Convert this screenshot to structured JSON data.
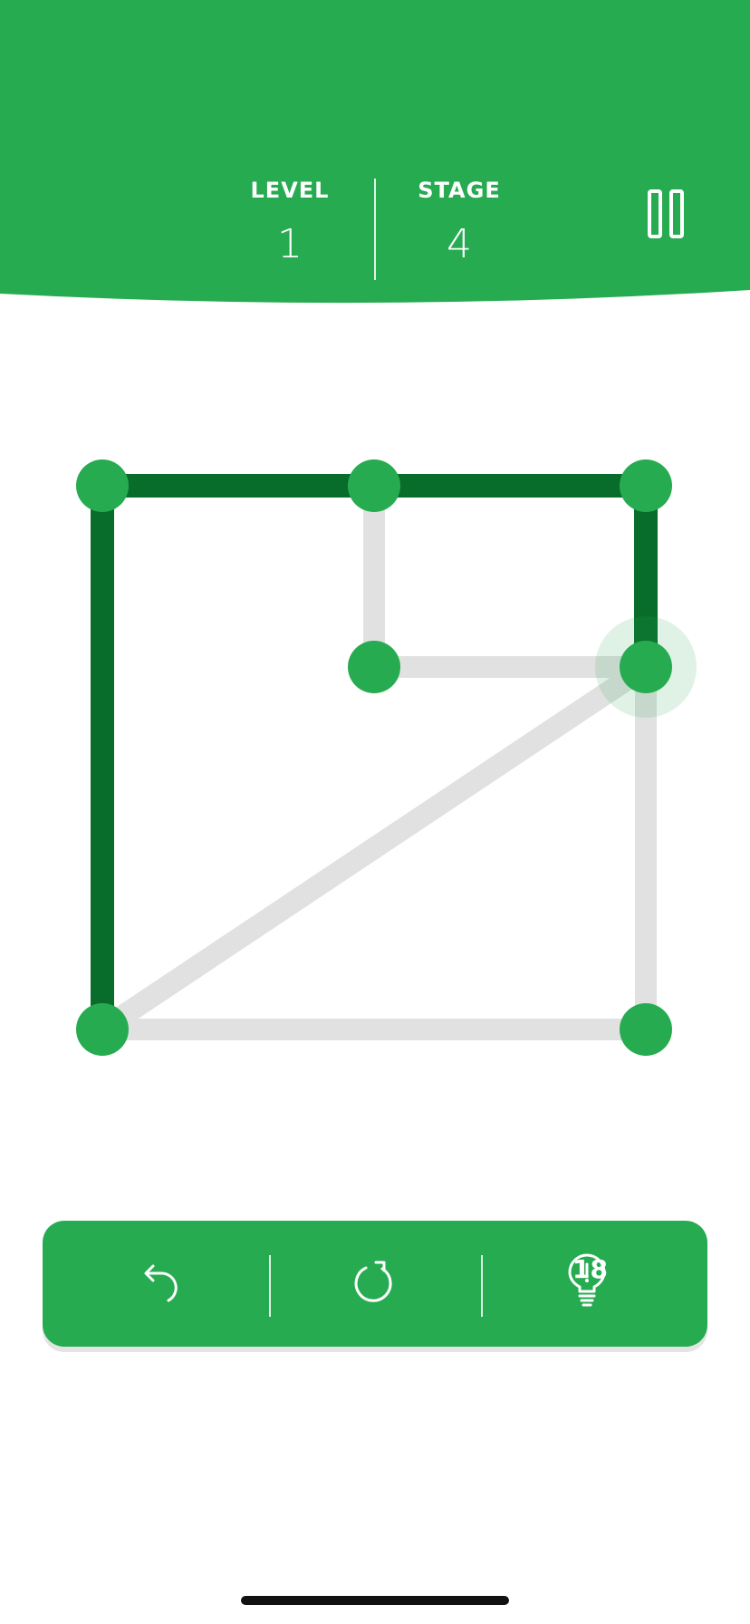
{
  "header": {
    "level_label": "LEVEL",
    "level_value": "1",
    "stage_label": "STAGE",
    "stage_value": "4",
    "pause_icon": "pause-icon"
  },
  "puzzle": {
    "nodes": [
      "top-left",
      "top-middle",
      "top-right",
      "center",
      "right-middle",
      "bottom-left",
      "bottom-right"
    ],
    "drawn_path": [
      "right-middle",
      "top-right",
      "top-middle",
      "top-left",
      "bottom-left"
    ],
    "remaining_edges": [
      [
        "top-middle",
        "center"
      ],
      [
        "center",
        "right-middle"
      ],
      [
        "right-middle",
        "bottom-left"
      ],
      [
        "right-middle",
        "bottom-right"
      ],
      [
        "bottom-left",
        "bottom-right"
      ]
    ],
    "current_node": "right-middle"
  },
  "toolbar": {
    "undo_icon": "undo-icon",
    "restart_icon": "restart-icon",
    "hint_icon": "lightbulb-icon",
    "hint_count": "18"
  },
  "colors": {
    "primary_green": "#27ab51",
    "drawn_line_green": "#086d2a",
    "remaining_line_gray": "#e1e1e1",
    "background": "#ffffff"
  }
}
